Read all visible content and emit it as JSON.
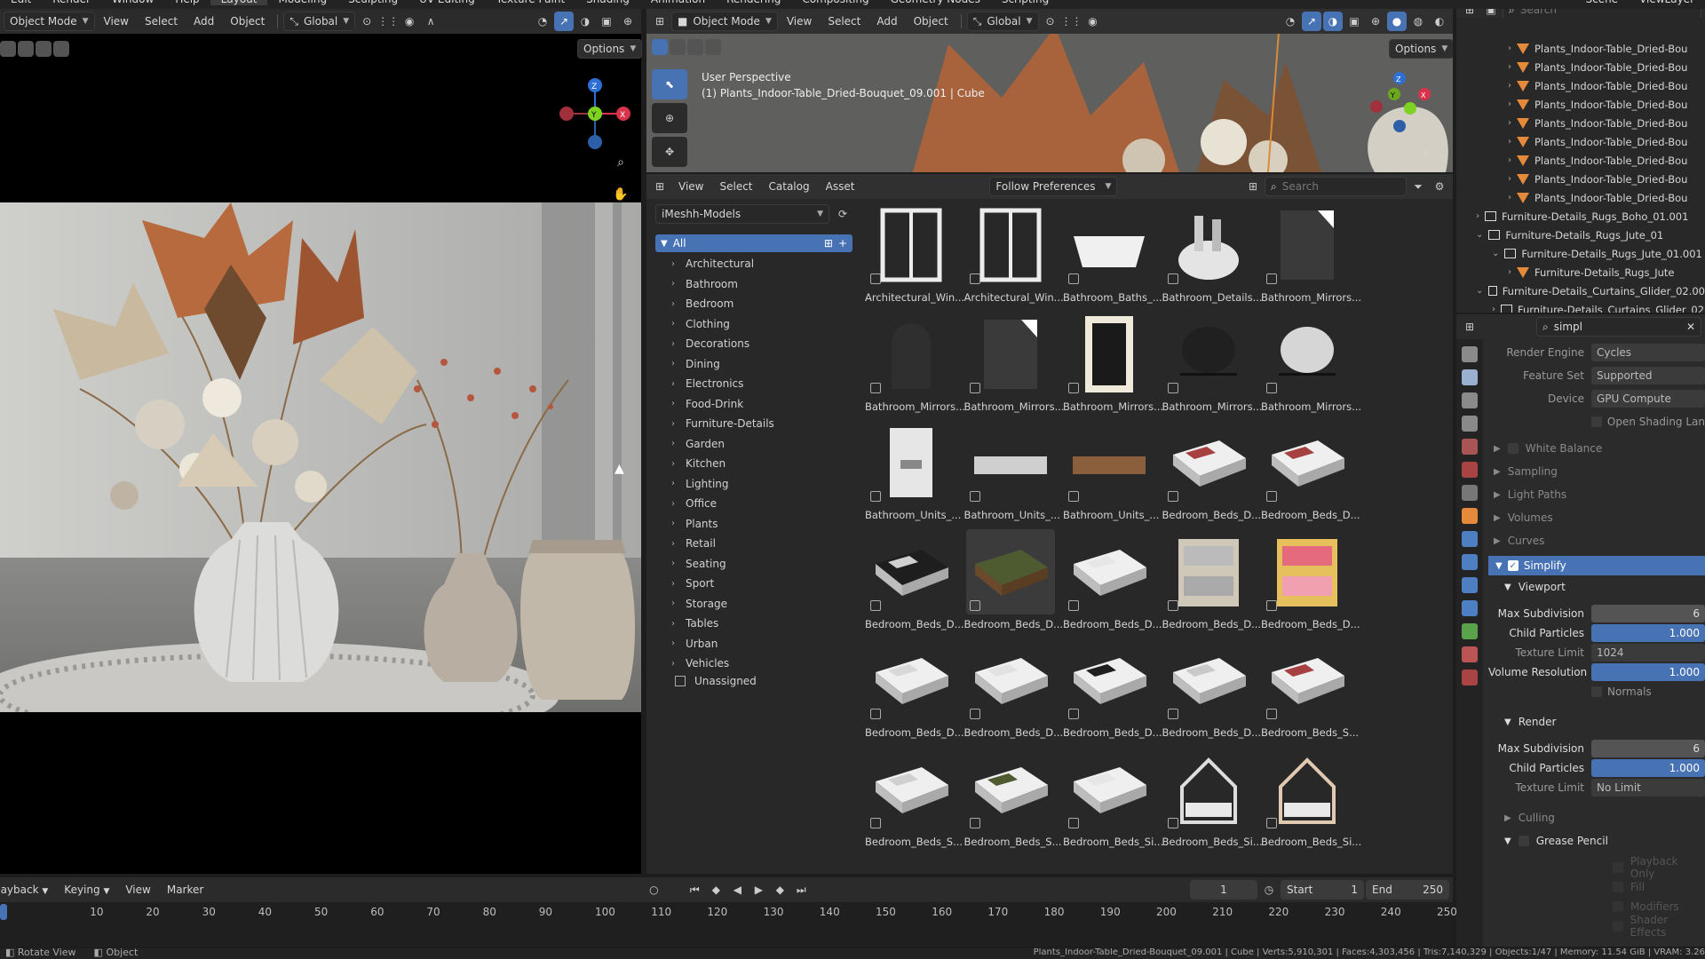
{
  "topbar": {
    "menu": [
      "Edit",
      "Render",
      "Window",
      "Help"
    ],
    "workspaces": [
      "Layout",
      "Modeling",
      "Sculpting",
      "UV Editing",
      "Texture Paint",
      "Shading",
      "Animation",
      "Rendering",
      "Compositing",
      "Geometry Nodes",
      "Scripting"
    ],
    "active_workspace": "Layout",
    "scene": "Scene",
    "viewlayer": "ViewLayer"
  },
  "left_viewport": {
    "mode": "Object Mode",
    "menu": [
      "View",
      "Select",
      "Add",
      "Object"
    ],
    "orientation": "Global",
    "options": "Options"
  },
  "mid_viewport": {
    "mode": "Object Mode",
    "menu": [
      "View",
      "Select",
      "Add",
      "Object"
    ],
    "orientation": "Global",
    "options": "Options",
    "perspective": "User Perspective",
    "object_info": "(1) Plants_Indoor-Table_Dried-Bouquet_09.001 | Cube"
  },
  "asset_browser": {
    "menu": [
      "View",
      "Select",
      "Catalog",
      "Asset"
    ],
    "import_method": "Follow Preferences",
    "search_placeholder": "Search",
    "library": "iMeshh-Models",
    "all_label": "All",
    "catalogs": [
      "Architectural",
      "Bathroom",
      "Bedroom",
      "Clothing",
      "Decorations",
      "Dining",
      "Electronics",
      "Food-Drink",
      "Furniture-Details",
      "Garden",
      "Kitchen",
      "Lighting",
      "Office",
      "Plants",
      "Retail",
      "Seating",
      "Sport",
      "Storage",
      "Tables",
      "Urban",
      "Vehicles"
    ],
    "unassigned": "Unassigned",
    "assets": [
      "Architectural_Win...",
      "Architectural_Win...",
      "Bathroom_Baths_...",
      "Bathroom_Details...",
      "Bathroom_Mirrors...",
      "Bathroom_Mirrors...",
      "Bathroom_Mirrors...",
      "Bathroom_Mirrors...",
      "Bathroom_Mirrors...",
      "Bathroom_Mirrors...",
      "Bathroom_Units_...",
      "Bathroom_Units_...",
      "Bathroom_Units_...",
      "Bedroom_Beds_D...",
      "Bedroom_Beds_D...",
      "Bedroom_Beds_D...",
      "Bedroom_Beds_D...",
      "Bedroom_Beds_D...",
      "Bedroom_Beds_D...",
      "Bedroom_Beds_D...",
      "Bedroom_Beds_D...",
      "Bedroom_Beds_D...",
      "Bedroom_Beds_D...",
      "Bedroom_Beds_D...",
      "Bedroom_Beds_S...",
      "Bedroom_Beds_S...",
      "Bedroom_Beds_S...",
      "Bedroom_Beds_Si...",
      "Bedroom_Beds_Si...",
      "Bedroom_Beds_Si..."
    ]
  },
  "outliner": {
    "search_placeholder": "Search",
    "items": [
      {
        "label": "Plants_Indoor-Table_Dried-Bou",
        "indent": 3,
        "type": "mesh"
      },
      {
        "label": "Plants_Indoor-Table_Dried-Bou",
        "indent": 3,
        "type": "mesh"
      },
      {
        "label": "Plants_Indoor-Table_Dried-Bou",
        "indent": 3,
        "type": "mesh"
      },
      {
        "label": "Plants_Indoor-Table_Dried-Bou",
        "indent": 3,
        "type": "mesh"
      },
      {
        "label": "Plants_Indoor-Table_Dried-Bou",
        "indent": 3,
        "type": "mesh"
      },
      {
        "label": "Plants_Indoor-Table_Dried-Bou",
        "indent": 3,
        "type": "mesh"
      },
      {
        "label": "Plants_Indoor-Table_Dried-Bou",
        "indent": 3,
        "type": "mesh"
      },
      {
        "label": "Plants_Indoor-Table_Dried-Bou",
        "indent": 3,
        "type": "mesh"
      },
      {
        "label": "Plants_Indoor-Table_Dried-Bou",
        "indent": 3,
        "type": "mesh"
      },
      {
        "label": "Furniture-Details_Rugs_Boho_01.001",
        "indent": 1,
        "type": "collection"
      },
      {
        "label": "Furniture-Details_Rugs_Jute_01",
        "indent": 1,
        "type": "collection"
      },
      {
        "label": "Furniture-Details_Rugs_Jute_01.001",
        "indent": 2,
        "type": "collection"
      },
      {
        "label": "Furniture-Details_Rugs_Jute",
        "indent": 3,
        "type": "mesh"
      },
      {
        "label": "Furniture-Details_Curtains_Glider_02.00",
        "indent": 1,
        "type": "collection"
      },
      {
        "label": "Furniture-Details_Curtains_Glider_02",
        "indent": 2,
        "type": "collection"
      }
    ]
  },
  "properties": {
    "search_value": "simpl",
    "render_engine_label": "Render Engine",
    "render_engine": "Cycles",
    "feature_set_label": "Feature Set",
    "feature_set": "Supported",
    "device_label": "Device",
    "device": "GPU Compute",
    "open_shading": "Open Shading Lan",
    "panels": [
      "White Balance",
      "Sampling",
      "Light Paths",
      "Volumes",
      "Curves"
    ],
    "simplify": "Simplify",
    "viewport": "Viewport",
    "max_subdivision_label": "Max Subdivision",
    "vp_max_subdivision": "6",
    "child_particles_label": "Child Particles",
    "vp_child_particles": "1.000",
    "texture_limit_label": "Texture Limit",
    "vp_texture_limit": "1024",
    "volume_resolution_label": "Volume Resolution",
    "vp_volume_resolution": "1.000",
    "normals": "Normals",
    "render": "Render",
    "r_max_subdivision": "6",
    "r_child_particles": "1.000",
    "r_texture_limit": "No Limit",
    "culling": "Culling",
    "grease_pencil": "Grease Pencil",
    "gp_items": [
      "Playback Only",
      "Fill",
      "Modifiers",
      "Shader Effects"
    ]
  },
  "timeline": {
    "menu": [
      "Playback",
      "Keying",
      "View",
      "Marker"
    ],
    "current_frame": "1",
    "start_label": "Start",
    "start": "1",
    "end_label": "End",
    "end": "250",
    "ticks": [
      "0",
      "10",
      "20",
      "30",
      "40",
      "50",
      "60",
      "70",
      "80",
      "90",
      "100",
      "110",
      "120",
      "130",
      "140",
      "150",
      "160",
      "170",
      "180",
      "190",
      "200",
      "210",
      "220",
      "230",
      "240",
      "250"
    ]
  },
  "status": {
    "left": [
      "Rotate View",
      "Object"
    ],
    "right": "Plants_Indoor-Table_Dried-Bouquet_09.001 | Cube | Verts:5,910,301 | Faces:4,303,456 | Tris:7,140,329 | Objects:1/47 | Memory: 11.54 GiB | VRAM: 3.26"
  },
  "colors": {
    "accent": "#4772b3",
    "mesh_icon": "#e48a3a",
    "bg": "#282828"
  }
}
